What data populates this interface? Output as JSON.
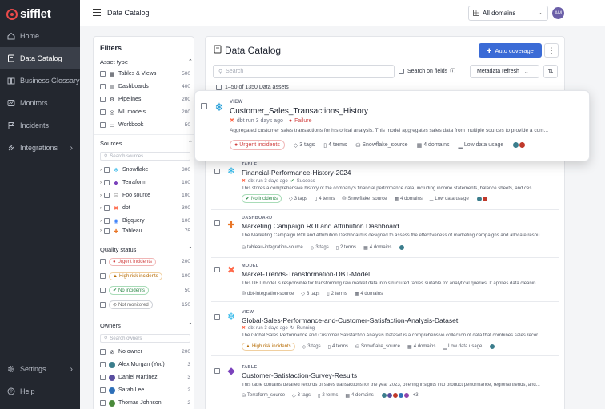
{
  "app": {
    "logo": "sifflet"
  },
  "sidebar": {
    "items": [
      {
        "label": "Home",
        "icon": "home-icon"
      },
      {
        "label": "Data Catalog",
        "icon": "catalog-icon",
        "active": true
      },
      {
        "label": "Business Glossary",
        "icon": "book-icon"
      },
      {
        "label": "Monitors",
        "icon": "monitor-icon"
      },
      {
        "label": "Incidents",
        "icon": "flag-icon"
      },
      {
        "label": "Integrations",
        "icon": "plug-icon"
      }
    ],
    "bottom": [
      {
        "label": "Settings",
        "icon": "gear-icon"
      },
      {
        "label": "Help",
        "icon": "help-icon"
      }
    ]
  },
  "topbar": {
    "title": "Data Catalog",
    "domain_select": "All domains",
    "avatar": "AM"
  },
  "filters": {
    "title": "Filters",
    "asset_type": {
      "label": "Asset type",
      "items": [
        {
          "label": "Tables & Views",
          "count": "500"
        },
        {
          "label": "Dashboards",
          "count": "400"
        },
        {
          "label": "Pipelines",
          "count": "200"
        },
        {
          "label": "ML models",
          "count": "200"
        },
        {
          "label": "Workbook",
          "count": "50"
        }
      ]
    },
    "sources": {
      "label": "Sources",
      "search_placeholder": "Search sources",
      "items": [
        {
          "label": "Snowflake",
          "count": "300"
        },
        {
          "label": "Terraform",
          "count": "100"
        },
        {
          "label": "Foo source",
          "count": "100"
        },
        {
          "label": "dbt",
          "count": "300"
        },
        {
          "label": "Bigquery",
          "count": "100"
        },
        {
          "label": "Tableau",
          "count": "75"
        }
      ]
    },
    "quality": {
      "label": "Quality status",
      "items": [
        {
          "label": "Urgent incidents",
          "count": "200"
        },
        {
          "label": "High risk incidents",
          "count": "100"
        },
        {
          "label": "No incidents",
          "count": "50"
        },
        {
          "label": "Not monitored",
          "count": "150"
        }
      ]
    },
    "owners": {
      "label": "Owners",
      "search_placeholder": "Search owners",
      "items": [
        {
          "label": "No owner",
          "count": "200"
        },
        {
          "label": "Alex Morgan (You)",
          "count": "3"
        },
        {
          "label": "Daniel Martinez",
          "count": "3"
        },
        {
          "label": "Sarah Lee",
          "count": "2"
        },
        {
          "label": "Thomas Johnson",
          "count": "2"
        }
      ]
    }
  },
  "catalog": {
    "title": "Data Catalog",
    "auto_coverage": "Auto coverage",
    "search_placeholder": "Search",
    "search_on_fields": "Search on fields",
    "sort": "Metadata refresh",
    "count_text": "1–50 of 1350 Data assets",
    "rows": [
      {
        "type": "VIEW",
        "name": "Customer_Sales_Transactions_History",
        "run": "dbt run 3 days ago",
        "run_status": "Failure",
        "description": "Aggregated customer sales transactions for historical analysis. This model aggregates sales data from multiple sources to provide a com...",
        "badge": "Urgent incidents",
        "source": "",
        "tags": "3 tags",
        "terms": "4 terms",
        "source2": "Snowflake_source",
        "domains": "4 domains",
        "usage": "Low data usage"
      },
      {
        "type": "TABLE",
        "name": "Financial-Performance-History-2024",
        "run": "dbt run 3 days ago",
        "run_status": "Success",
        "description": "This stores a comprehensive history of the company's financial performance data, including income statements, balance sheets, and ces...",
        "badge": "No incidents",
        "tags": "3 tags",
        "terms": "4 terms",
        "source2": "Snowflake_source",
        "domains": "4 domains",
        "usage": "Low data usage"
      },
      {
        "type": "DASHBOARD",
        "name": "Marketing Campaign ROI and Attribution Dashboard",
        "description": "The Marketing Campaign ROI and Attribution Dashboard is designed to assess the effectiveness of marketing campaigns and allocate resou...",
        "source": "tableau-integration-source",
        "tags": "3 tags",
        "terms": "2 terms",
        "domains": "4 domains"
      },
      {
        "type": "MODEL",
        "name": "Market-Trends-Transformation-DBT-Model",
        "description": "This DBT model is responsible for transforming raw market data into structured tables suitable for analytical queries. It applies data cleanin...",
        "source": "dbt-integration-source",
        "tags": "3 tags",
        "terms": "2 terms",
        "domains": "4 domains"
      },
      {
        "type": "VIEW",
        "name": "Global-Sales-Performance-and-Customer-Satisfaction-Analysis-Dataset",
        "run": "dbt run 3 days ago",
        "run_status": "Running",
        "description": "The Global Sales Performance and Customer Satisfaction Analysis Dataset is a comprehensive collection of data that combines sales recor...",
        "badge": "High risk incidents",
        "tags": "3 tags",
        "terms": "4 terms",
        "source2": "Snowflake_source",
        "domains": "4 domains",
        "usage": "Low data usage"
      },
      {
        "type": "TABLE",
        "name": "Customer-Satisfaction-Survey-Results",
        "description": "This table contains detailed records of sales transactions for the year 2023, offering insights into product performance, regional trends, and...",
        "source": "Terraform_source",
        "tags": "3 tags",
        "terms": "2 terms",
        "domains": "4 domains",
        "more_owners": "+3"
      }
    ]
  },
  "colors": {
    "accent": "#3b6bd6",
    "sidebar": "#23272f",
    "urgent": "#d14343",
    "success": "#2f8a4a",
    "warning": "#b66a00"
  }
}
